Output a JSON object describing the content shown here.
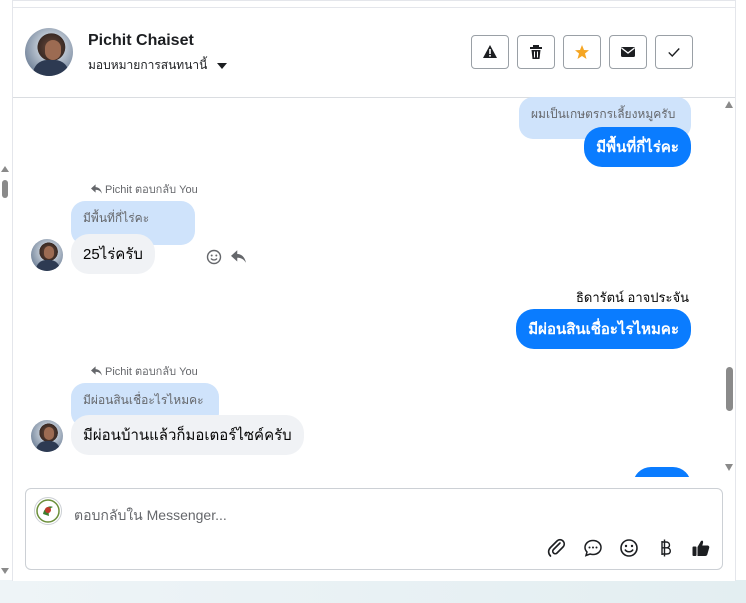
{
  "header": {
    "contact_name": "Pichit Chaiset",
    "assign_label": "มอบหมายการสนทนานี้"
  },
  "actions": [
    {
      "icon": "warning-icon",
      "name": "mark-spam-button"
    },
    {
      "icon": "trash-icon",
      "name": "delete-button"
    },
    {
      "icon": "star-icon",
      "name": "star-button",
      "color": "#f5a623"
    },
    {
      "icon": "envelope-icon",
      "name": "mark-unread-button"
    },
    {
      "icon": "check-icon",
      "name": "mark-done-button"
    }
  ],
  "messages": {
    "m1_quote": "ผมเป็นเกษตรกรเลี้ยงหมูครับ",
    "m1_text": "มีพื้นที่กี่ไร่คะ",
    "m2_reply_label": "Pichit ตอบกลับ You",
    "m2_quote": "มีพื้นที่กี่ไร่คะ",
    "m2_text": "25ไร่ครับ",
    "m3_sender": "ธิดารัตน์ อาจประจัน",
    "m3_text": "มีผ่อนสินเชื่อะไรไหมคะ",
    "m4_reply_label": "Pichit ตอบกลับ You",
    "m4_quote": "มีผ่อนสินเชื่อะไรไหมคะ",
    "m4_text": "มีผ่อนบ้านแล้วก็มอเตอร์ไซค์ครับ"
  },
  "composer": {
    "placeholder": "ตอบกลับใน Messenger..."
  },
  "colors": {
    "outgoing": "#0a7cff",
    "quote_bg": "#cfe3fb",
    "incoming": "#f0f2f5"
  }
}
